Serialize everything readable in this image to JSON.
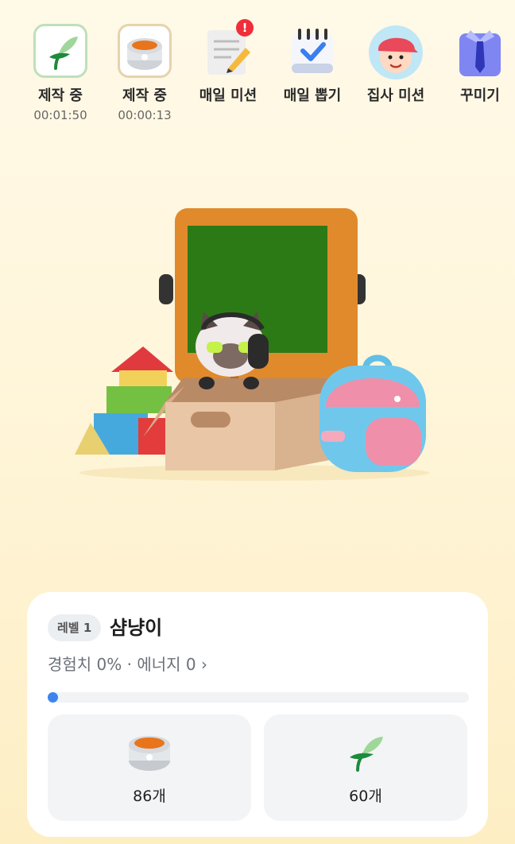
{
  "top_menu": [
    {
      "label": "제작 중",
      "timer": "00:01:50",
      "icon": "leaf-crafting-icon"
    },
    {
      "label": "제작 중",
      "timer": "00:00:13",
      "icon": "food-bowl-crafting-icon"
    },
    {
      "label": "매일 미션",
      "icon": "notepad-pencil-icon",
      "badge": "!"
    },
    {
      "label": "매일 뽑기",
      "icon": "calendar-check-icon"
    },
    {
      "label": "집사 미션",
      "icon": "boy-cap-avatar-icon"
    },
    {
      "label": "꾸미기",
      "icon": "shirt-tie-icon"
    }
  ],
  "pet": {
    "level": "레벨 1",
    "name": "샴냥이",
    "stats": "경험치 0% · 에너지 0 ›",
    "experience_fraction": 0.0
  },
  "inventory": [
    {
      "icon": "food-bowl-icon",
      "count": "86개"
    },
    {
      "icon": "leaf-icon",
      "count": "60개"
    }
  ],
  "colors": {
    "accent": "#3d84ef",
    "badge": "#ef2e3a",
    "card_bg": "#ffffff",
    "tile_bg": "#f3f4f6"
  }
}
